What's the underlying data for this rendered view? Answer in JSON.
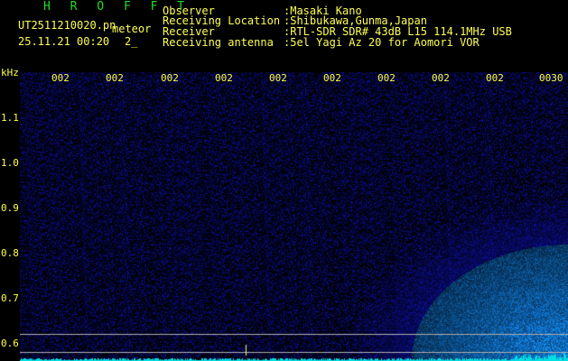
{
  "header": {
    "app_name": "H R O F F T",
    "filename": "UT2511210020.pn",
    "mode": "meteor",
    "datetime": "25.11.21 00:20",
    "count": "2_",
    "fields": [
      {
        "label": "Observer",
        "value": ":Masaki Kano"
      },
      {
        "label": "Receiving Location",
        "value": ":Shibukawa,Gunma,Japan"
      },
      {
        "label": "Receiver",
        "value": ":RTL-SDR SDR# 43dB L15 114.1MHz USB"
      },
      {
        "label": "Receiving antenna",
        "value": ":5el Yagi Az 20 for Aomori VOR"
      }
    ]
  },
  "axis": {
    "unit": "kHz",
    "y_ticks": [
      "1.1",
      "1.0",
      "0.9",
      "0.8",
      "0.7",
      "0.6"
    ],
    "x_ticks": [
      "002",
      "002",
      "002",
      "002",
      "002",
      "002",
      "002",
      "002",
      "002",
      "0030"
    ]
  },
  "colors": {
    "text": "#ffff55",
    "title": "#22dd22",
    "noise": "#1a1aa0",
    "baseline": "#00e0e0",
    "marker_lines": "#b0b0b0"
  }
}
